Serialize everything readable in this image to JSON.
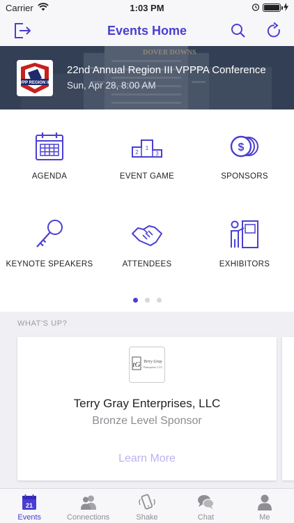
{
  "status_bar": {
    "carrier": "Carrier",
    "time": "1:03 PM"
  },
  "nav": {
    "title": "Events Home",
    "left_icon": "logout-icon",
    "search_icon": "search-icon",
    "refresh_icon": "refresh-icon"
  },
  "banner": {
    "title": "22nd Annual Region III VPPPA Conference",
    "date": "Sun, Apr 28, 8:00 AM",
    "logo_text": "VPP REGION III",
    "background_sign": "DOVER DOWNS"
  },
  "grid": {
    "items": [
      {
        "label": "AGENDA",
        "icon": "calendar-icon"
      },
      {
        "label": "EVENT GAME",
        "icon": "podium-icon"
      },
      {
        "label": "SPONSORS",
        "icon": "coins-icon"
      },
      {
        "label": "KEYNOTE SPEAKERS",
        "icon": "key-icon"
      },
      {
        "label": "ATTENDEES",
        "icon": "handshake-icon"
      },
      {
        "label": "EXHIBITORS",
        "icon": "presenter-icon"
      }
    ],
    "page_count": 3,
    "active_page": 1
  },
  "whatsup": {
    "label": "WHAT'S UP?",
    "card": {
      "name": "Terry Gray Enterprises, LLC",
      "level": "Bronze Level Sponsor",
      "link": "Learn More",
      "logo_text": "Terry Gray Enterprises, LLC"
    }
  },
  "tabs": [
    {
      "label": "Events",
      "icon": "calendar-21-icon",
      "active": true
    },
    {
      "label": "Connections",
      "icon": "people-icon",
      "active": false
    },
    {
      "label": "Shake",
      "icon": "shake-phone-icon",
      "active": false
    },
    {
      "label": "Chat",
      "icon": "chat-bubbles-icon",
      "active": false
    },
    {
      "label": "Me",
      "icon": "person-icon",
      "active": false
    }
  ],
  "colors": {
    "accent": "#4a3fd1",
    "muted": "#8e8e93",
    "link_faded": "#b9b3ee"
  }
}
